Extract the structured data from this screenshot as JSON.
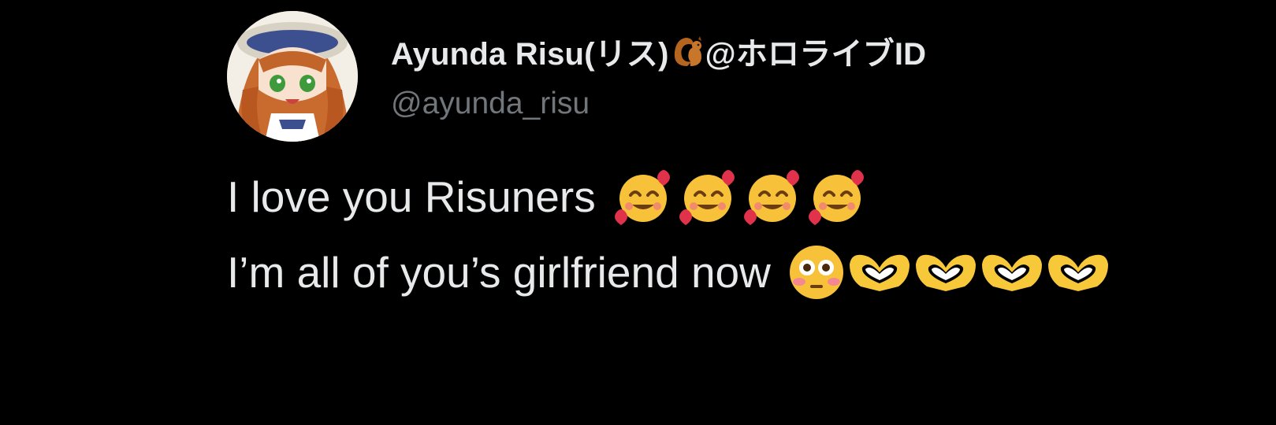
{
  "tweet": {
    "author": {
      "display_name": "Ayunda Risu(リス)",
      "name_suffix": "@ホロライブID",
      "handle": "@ayunda_risu",
      "name_emoji": "squirrel-icon",
      "avatar": "avatar"
    },
    "lines": [
      {
        "text": "I love you Risuners",
        "emojis": [
          "smiling-face-with-hearts-icon",
          "smiling-face-with-hearts-icon",
          "smiling-face-with-hearts-icon",
          "smiling-face-with-hearts-icon"
        ]
      },
      {
        "text": "I’m all of you’s girlfriend now",
        "emojis": [
          "flushed-face-icon",
          "heart-hands-icon",
          "heart-hands-icon",
          "heart-hands-icon",
          "heart-hands-icon"
        ]
      }
    ]
  },
  "colors": {
    "background": "#000000",
    "primary_text": "#e7e9ea",
    "secondary_text": "#71767b"
  }
}
